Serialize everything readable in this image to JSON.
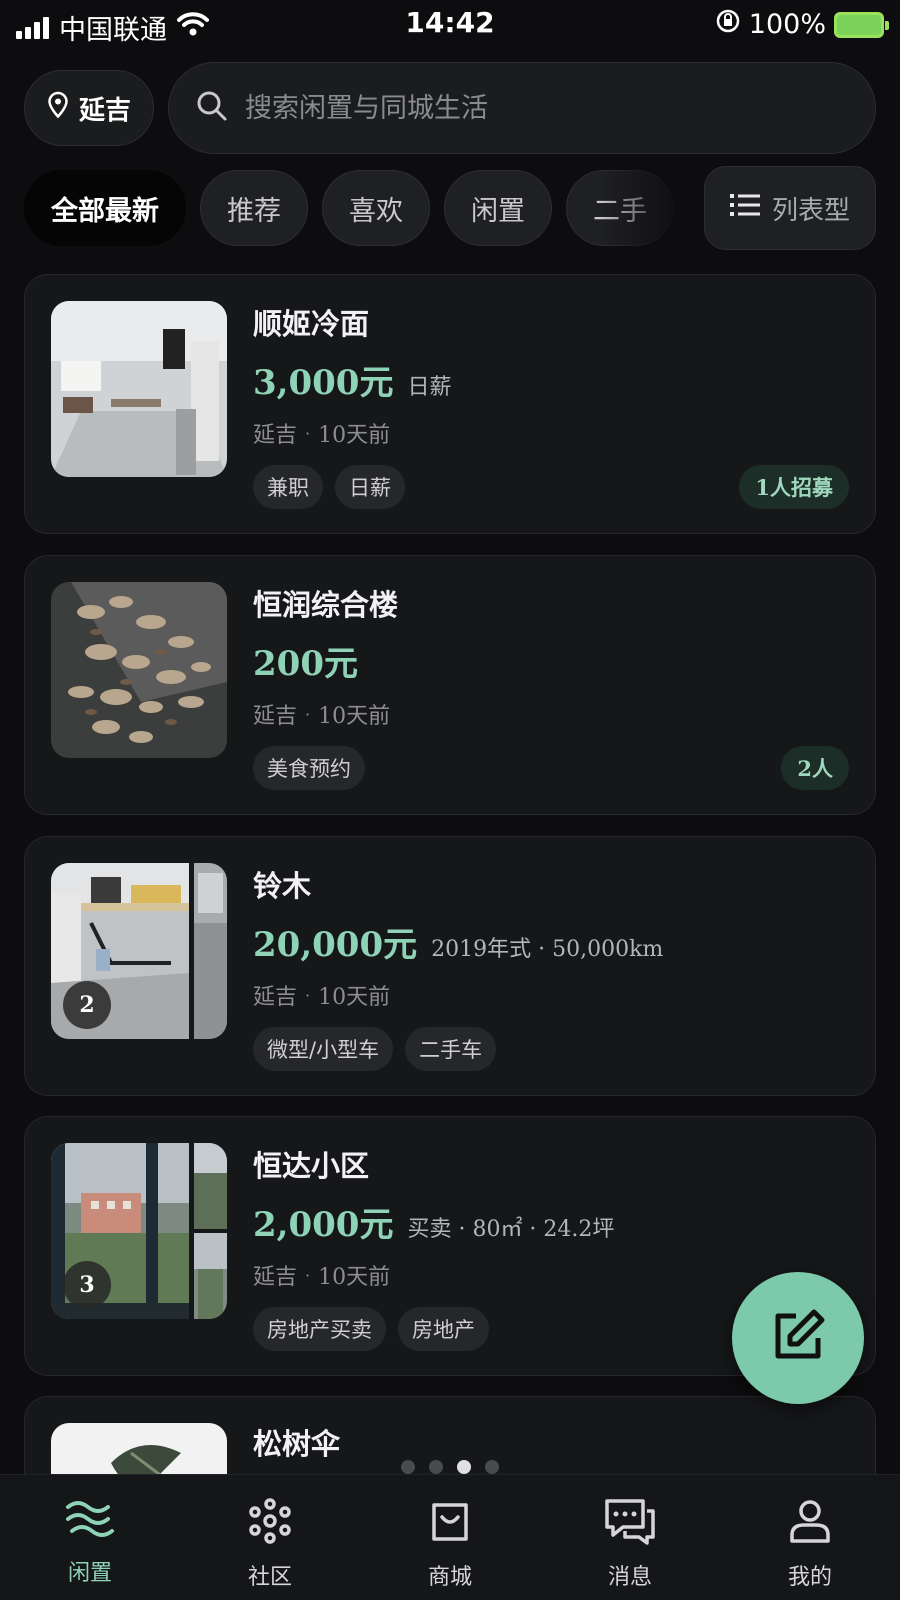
{
  "status_bar": {
    "carrier": "中国联通",
    "time": "14:42",
    "battery": "100%"
  },
  "header": {
    "location": "延吉",
    "search_placeholder": "搜索闲置与同城生活"
  },
  "filters": {
    "chips": [
      "全部最新",
      "推荐",
      "喜欢",
      "闲置",
      "二手"
    ],
    "active_index": 0,
    "view_toggle": "列表型"
  },
  "listings": [
    {
      "title": "顺姬冷面",
      "price": "3,000元",
      "meta": "日薪",
      "location": "延吉",
      "time": "10天前",
      "tags": [
        "兼职",
        "日薪"
      ],
      "badge": "1人招募",
      "image_count": ""
    },
    {
      "title": "恒润综合楼",
      "price": "200元",
      "meta": "",
      "location": "延吉",
      "time": "10天前",
      "tags": [
        "美食预约"
      ],
      "badge": "2人",
      "image_count": ""
    },
    {
      "title": "铃木",
      "price": "20,000元",
      "meta": "2019年式 · 50,000km",
      "location": "延吉",
      "time": "10天前",
      "tags": [
        "微型/小型车",
        "二手车"
      ],
      "badge": "",
      "image_count": "2"
    },
    {
      "title": "恒达小区",
      "price": "2,000元",
      "meta": "买卖 · 80㎡ · 24.2坪",
      "location": "延吉",
      "time": "10天前",
      "tags": [
        "房地产买卖",
        "房地产"
      ],
      "badge": "",
      "image_count": "3"
    },
    {
      "title": "松树伞"
    }
  ],
  "separator_dot": "·",
  "pager": {
    "count": 4,
    "active": 2
  },
  "tabbar": {
    "items": [
      "闲置",
      "社区",
      "商城",
      "消息",
      "我的"
    ],
    "active_index": 0
  },
  "colors": {
    "accent": "#8fd3b6",
    "fab": "#7dc9ac",
    "background": "#0d0d0f",
    "card": "#161719"
  }
}
